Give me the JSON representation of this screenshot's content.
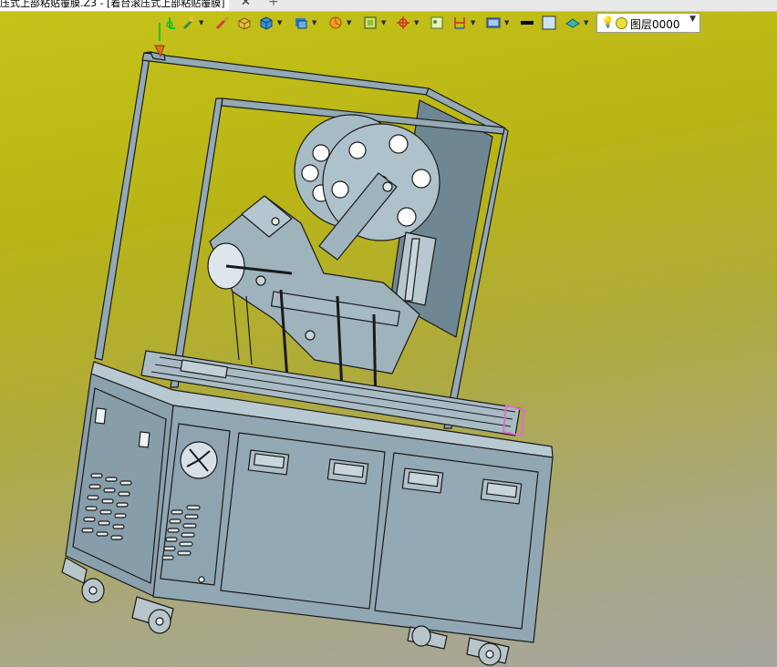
{
  "window": {
    "tab_title": "压式上部粘贴覆膜.Z3 - [着台滚压式上部粘贴覆膜]",
    "close_glyph": "✕",
    "add_glyph": "+"
  },
  "toolbar": {
    "icons": [
      "axis-icon",
      "pen-icon",
      "brush-icon",
      "box-icon",
      "cube-icon",
      "layers-icon",
      "pie-icon",
      "frame-icon",
      "target-icon",
      "image-icon",
      "bracket-icon",
      "render-icon",
      "line-weight-icon",
      "color-swatch-icon",
      "visibility-icon"
    ]
  },
  "layer_selector": {
    "value": "图层0000"
  },
  "colors": {
    "machine_body": "#8fa6b2",
    "machine_dark": "#6a8290",
    "accent_pink": "#e06fc8",
    "edge": "#1a1a1a"
  }
}
